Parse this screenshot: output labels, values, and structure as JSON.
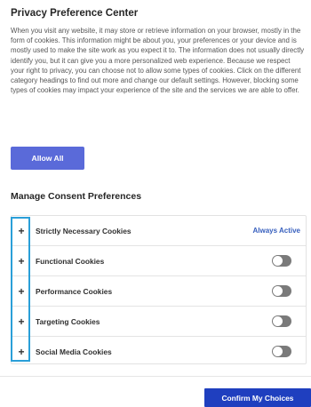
{
  "header": {
    "title": "Privacy Preference Center"
  },
  "description": "When you visit any website, it may store or retrieve information on your browser, mostly in the form of cookies. This information might be about you, your preferences or your device and is mostly used to make the site work as you expect it to. The information does not usually directly identify you, but it can give you a more personalized web experience. Because we respect your right to privacy, you can choose not to allow some types of cookies. Click on the different category headings to find out more and change our default settings. However, blocking some types of cookies may impact your experience of the site and the services we are able to offer.",
  "allow_all_label": "Allow All",
  "manage": {
    "title": "Manage Consent Preferences",
    "expand_symbol": "+",
    "categories": [
      {
        "label": "Strictly Necessary Cookies",
        "status": "Always Active",
        "toggle_on": null
      },
      {
        "label": "Functional Cookies",
        "status": "",
        "toggle_on": false
      },
      {
        "label": "Performance Cookies",
        "status": "",
        "toggle_on": false
      },
      {
        "label": "Targeting Cookies",
        "status": "",
        "toggle_on": false
      },
      {
        "label": "Social Media Cookies",
        "status": "",
        "toggle_on": false
      }
    ]
  },
  "footer": {
    "confirm_label": "Confirm My Choices"
  },
  "colors": {
    "primary_button": "#5a6ad9",
    "confirm_button": "#1f3fbf",
    "always_active_text": "#3860be",
    "toggle_off": "#7a7a7a",
    "focus_outline": "#2a9fd8"
  }
}
